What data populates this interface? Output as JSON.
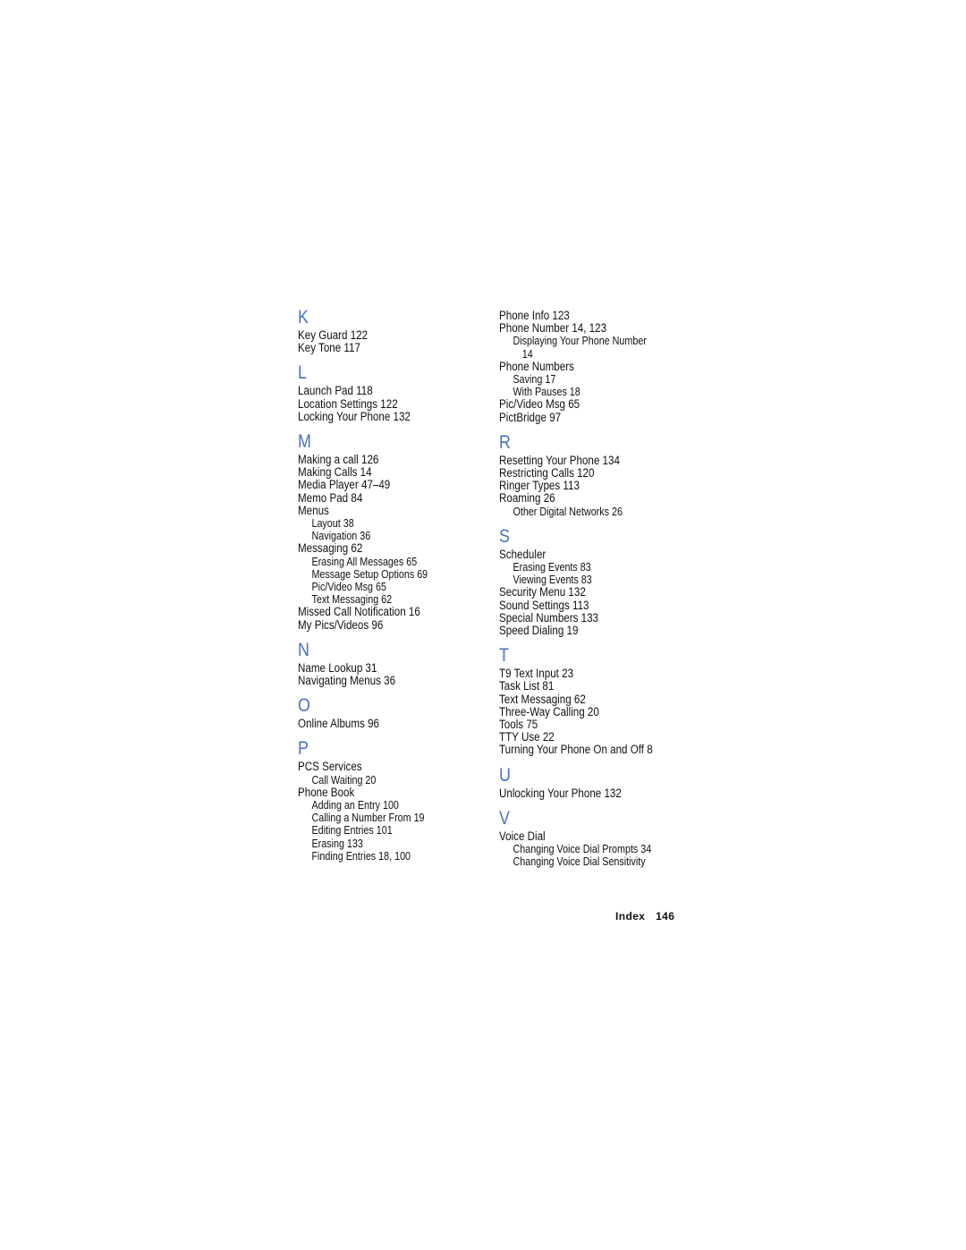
{
  "left_column": [
    {
      "letter": "K",
      "entries": [
        {
          "text": "Key Guard 122",
          "level": 0
        },
        {
          "text": "Key Tone 117",
          "level": 0
        }
      ]
    },
    {
      "letter": "L",
      "entries": [
        {
          "text": "Launch Pad 118",
          "level": 0
        },
        {
          "text": "Location Settings 122",
          "level": 0
        },
        {
          "text": "Locking Your Phone 132",
          "level": 0
        }
      ]
    },
    {
      "letter": "M",
      "entries": [
        {
          "text": "Making a call 126",
          "level": 0
        },
        {
          "text": "Making Calls 14",
          "level": 0
        },
        {
          "text": "Media Player 47–49",
          "level": 0
        },
        {
          "text": "Memo Pad 84",
          "level": 0
        },
        {
          "text": "Menus",
          "level": 0
        },
        {
          "text": "Layout 38",
          "level": 1
        },
        {
          "text": "Navigation 36",
          "level": 1
        },
        {
          "text": "Messaging 62",
          "level": 0
        },
        {
          "text": "Erasing All Messages 65",
          "level": 1
        },
        {
          "text": "Message Setup Options 69",
          "level": 1
        },
        {
          "text": "Pic/Video Msg 65",
          "level": 1
        },
        {
          "text": "Text Messaging 62",
          "level": 1
        },
        {
          "text": "Missed Call Notification 16",
          "level": 0
        },
        {
          "text": "My Pics/Videos 96",
          "level": 0
        }
      ]
    },
    {
      "letter": "N",
      "entries": [
        {
          "text": "Name Lookup 31",
          "level": 0
        },
        {
          "text": "Navigating Menus 36",
          "level": 0
        }
      ]
    },
    {
      "letter": "O",
      "entries": [
        {
          "text": "Online Albums 96",
          "level": 0
        }
      ]
    },
    {
      "letter": "P",
      "entries": [
        {
          "text": "PCS Services",
          "level": 0
        },
        {
          "text": "Call Waiting 20",
          "level": 1
        },
        {
          "text": "Phone Book",
          "level": 0
        },
        {
          "text": "Adding an Entry 100",
          "level": 1
        },
        {
          "text": "Calling a Number From 19",
          "level": 1
        },
        {
          "text": "Editing Entries 101",
          "level": 1
        },
        {
          "text": "Erasing 133",
          "level": 1
        },
        {
          "text": "Finding Entries 18, 100",
          "level": 1
        }
      ]
    }
  ],
  "right_column": [
    {
      "letter": "",
      "entries": [
        {
          "text": "Phone Info 123",
          "level": 0
        },
        {
          "text": "Phone Number 14, 123",
          "level": 0
        },
        {
          "text": "Displaying Your Phone Number",
          "level": 1
        },
        {
          "text": "14",
          "level": 2
        },
        {
          "text": "Phone Numbers",
          "level": 0
        },
        {
          "text": "Saving 17",
          "level": 1
        },
        {
          "text": "With Pauses 18",
          "level": 1
        },
        {
          "text": "Pic/Video Msg 65",
          "level": 0
        },
        {
          "text": "PictBridge 97",
          "level": 0
        }
      ]
    },
    {
      "letter": "R",
      "entries": [
        {
          "text": "Resetting Your Phone 134",
          "level": 0
        },
        {
          "text": "Restricting Calls 120",
          "level": 0
        },
        {
          "text": "Ringer Types 113",
          "level": 0
        },
        {
          "text": "Roaming 26",
          "level": 0
        },
        {
          "text": "Other Digital Networks 26",
          "level": 1
        }
      ]
    },
    {
      "letter": "S",
      "entries": [
        {
          "text": "Scheduler",
          "level": 0
        },
        {
          "text": "Erasing Events 83",
          "level": 1
        },
        {
          "text": "Viewing Events 83",
          "level": 1
        },
        {
          "text": "Security Menu 132",
          "level": 0
        },
        {
          "text": "Sound Settings 113",
          "level": 0
        },
        {
          "text": "Special Numbers 133",
          "level": 0
        },
        {
          "text": "Speed Dialing 19",
          "level": 0
        }
      ]
    },
    {
      "letter": "T",
      "entries": [
        {
          "text": "T9 Text Input 23",
          "level": 0
        },
        {
          "text": "Task List 81",
          "level": 0
        },
        {
          "text": "Text Messaging 62",
          "level": 0
        },
        {
          "text": "Three-Way Calling 20",
          "level": 0
        },
        {
          "text": "Tools 75",
          "level": 0
        },
        {
          "text": "TTY Use 22",
          "level": 0
        },
        {
          "text": "Turning Your Phone On and Off 8",
          "level": 0
        }
      ]
    },
    {
      "letter": "U",
      "entries": [
        {
          "text": "Unlocking Your Phone 132",
          "level": 0
        }
      ]
    },
    {
      "letter": "V",
      "entries": [
        {
          "text": "Voice Dial",
          "level": 0
        },
        {
          "text": "Changing Voice Dial Prompts 34",
          "level": 1
        },
        {
          "text": "Changing Voice Dial Sensitivity",
          "level": 1
        }
      ]
    }
  ],
  "footer": {
    "section": "Index",
    "page": "146"
  },
  "colors": {
    "letter_heading": "#4a6fbf",
    "text": "#111111"
  }
}
